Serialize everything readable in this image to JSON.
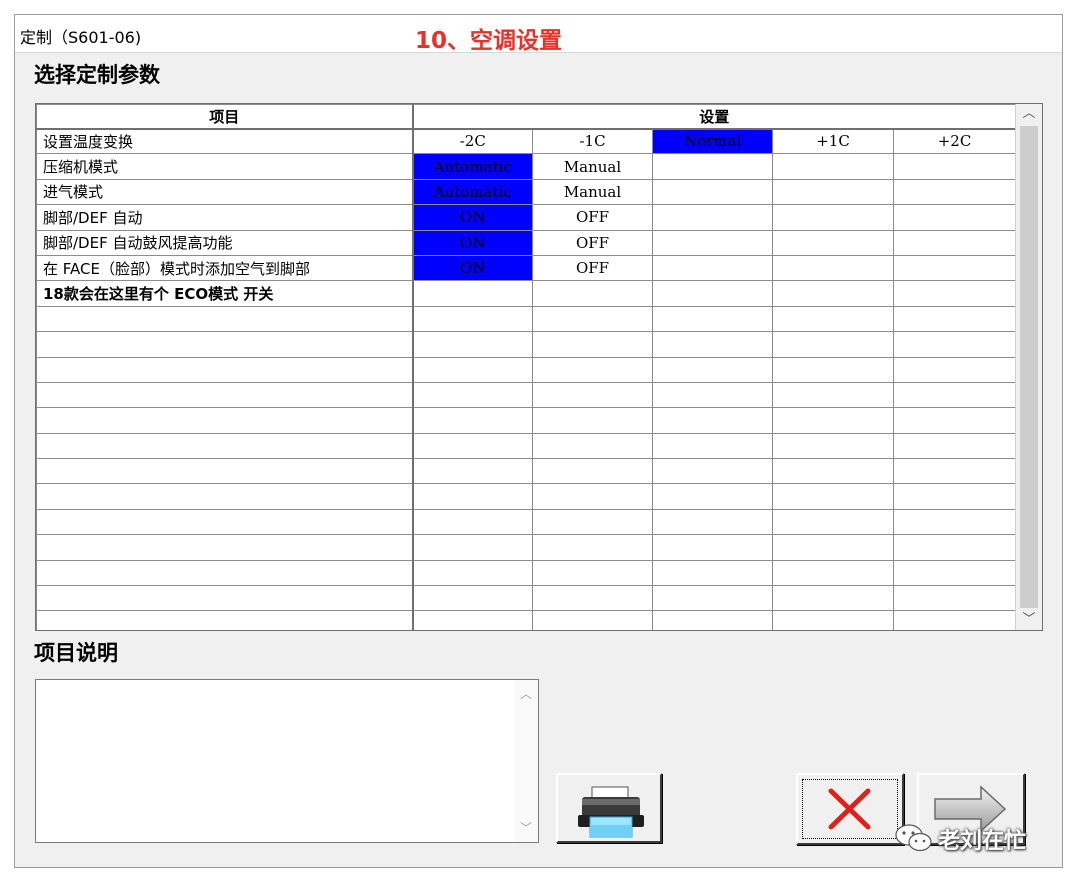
{
  "window": {
    "title": "定制（S601-06)",
    "annotation": "10、空调设置"
  },
  "section_heading": "选择定制参数",
  "grid": {
    "headers": {
      "item": "项目",
      "setting": "设置"
    },
    "rows": [
      {
        "item": "设置温度变换",
        "cells": [
          "-2C",
          "-1C",
          "Normal",
          "+1C",
          "+2C"
        ],
        "selected": 2
      },
      {
        "item": "压缩机模式",
        "cells": [
          "Automatic",
          "Manual",
          "",
          "",
          ""
        ],
        "selected": 0
      },
      {
        "item": "进气模式",
        "cells": [
          "Automatic",
          "Manual",
          "",
          "",
          ""
        ],
        "selected": 0
      },
      {
        "item": "脚部/DEF 自动",
        "cells": [
          "ON",
          "OFF",
          "",
          "",
          ""
        ],
        "selected": 0
      },
      {
        "item": "脚部/DEF 自动鼓风提高功能",
        "cells": [
          "ON",
          "OFF",
          "",
          "",
          ""
        ],
        "selected": 0
      },
      {
        "item": "在 FACE（脸部）模式时添加空气到脚部",
        "cells": [
          "ON",
          "OFF",
          "",
          "",
          ""
        ],
        "selected": 0
      },
      {
        "item": "18款会在这里有个 ECO模式 开关",
        "cells": [
          "",
          "",
          "",
          "",
          ""
        ],
        "selected": -1,
        "note": true
      }
    ],
    "empty_rows": 13
  },
  "description": {
    "heading": "项目说明",
    "text": ""
  },
  "buttons": {
    "print_icon": "printer-icon",
    "cancel_icon": "red-x-icon",
    "next_icon": "arrow-right-icon"
  },
  "watermark": {
    "icon": "wechat-icon",
    "text": "老刘在忙"
  },
  "colors": {
    "selected_bg": "#0000ff",
    "annotation_red": "#e8312a"
  }
}
